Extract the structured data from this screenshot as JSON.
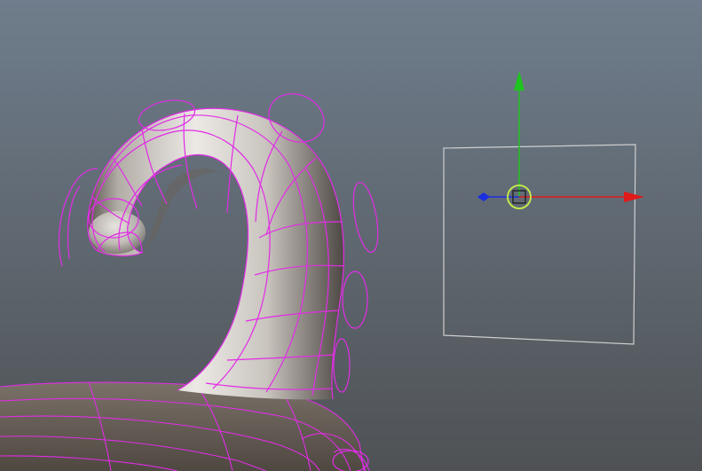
{
  "viewport": {
    "name": "3d-modeling-viewport",
    "background_top": "#6f7d8c",
    "background_bottom": "#4f5255"
  },
  "colors": {
    "wireframe": "#e22ce6",
    "control_curve": "#e22ce6",
    "surface_light": "#ece9e5",
    "surface_mid": "#b3ada7",
    "surface_dark": "#5a544f",
    "body_surface": "#6a625a",
    "selection_box": "#cfcfcf",
    "axis_x": "#e01a1a",
    "axis_y": "#1ec51e",
    "axis_z": "#1a2fe0",
    "center_handle": "#c8f04a"
  },
  "objects": [
    {
      "name": "tail-mesh",
      "kind": "nurbs-surface"
    },
    {
      "name": "body-mesh",
      "kind": "nurbs-surface"
    },
    {
      "name": "tail-control-curves",
      "kind": "circle-controls",
      "count": 7
    }
  ],
  "manipulator": {
    "type": "move-tool",
    "axes": [
      "x",
      "y",
      "z"
    ],
    "icons": {
      "x_handle": "arrow-right-icon",
      "y_handle": "arrow-up-icon",
      "z_handle": "diamond-icon",
      "center": "center-square-icon"
    }
  }
}
